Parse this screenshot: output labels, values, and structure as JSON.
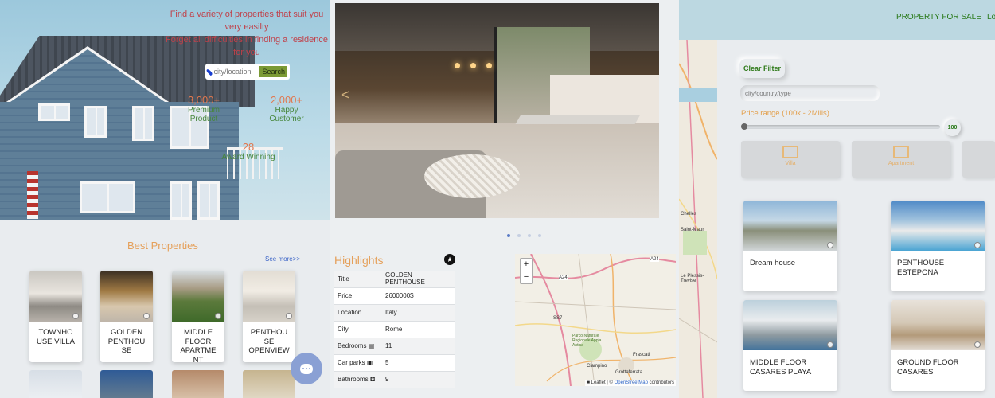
{
  "panel1": {
    "hero": {
      "line1": "Find a variety of properties that suit you very easilty",
      "line2": "Forget all difficulties in finding a residence for you"
    },
    "search": {
      "placeholder": "city/location",
      "button": "Search"
    },
    "stats": [
      {
        "num": "3,000+",
        "label": "Premium Product"
      },
      {
        "num": "2,000+",
        "label": "Happy Customer"
      },
      {
        "num": "28",
        "label": "Award Winning"
      }
    ],
    "section_title": "Best Properties",
    "see_more": "See more>>",
    "cards": [
      {
        "title": "TOWNHO USE VILLA"
      },
      {
        "title": "GOLDEN PENTHOU SE"
      },
      {
        "title": "MIDDLE FLOOR APARTME NT"
      },
      {
        "title": "PENTHOU SE OPENVIEW"
      }
    ],
    "chat_icon": "chat-icon"
  },
  "panel2": {
    "prev_arrow": "<",
    "highlights_title": "Highlights",
    "rows": [
      {
        "key": "Title",
        "value": "GOLDEN PENTHOUSE"
      },
      {
        "key": "Price",
        "value": "2600000$"
      },
      {
        "key": "Location",
        "value": "Italy"
      },
      {
        "key": "City",
        "value": "Rome"
      },
      {
        "key": "Bedrooms ▤",
        "value": "11"
      },
      {
        "key": "Car parks ▣",
        "value": "5"
      },
      {
        "key": "Bathrooms ⛾",
        "value": "9"
      }
    ],
    "map": {
      "zoom_in": "+",
      "zoom_out": "−",
      "attribution_prefix": "■ Leaflet | © ",
      "attribution_link": "OpenStreetMap",
      "attribution_suffix": " contributors",
      "labels": [
        "A24",
        "A24",
        "SS7",
        "Frascati",
        "Ciampino",
        "Grottaferrata",
        "Parco Naturale Regionale Appia Antica"
      ]
    }
  },
  "panel3": {
    "nav": [
      "PROPERTY FOR SALE",
      "Lo"
    ],
    "clear_filter": "Clear Filter",
    "city_placeholder": "city/country/type",
    "price_label": "Price range (100k - 2Mills)",
    "price_value": "100",
    "type_tiles": [
      {
        "label": "Villa"
      },
      {
        "label": "Apartment"
      },
      {
        "label": ""
      }
    ],
    "cards": [
      {
        "title": "Dream house"
      },
      {
        "title": "PENTHOUSE ESTEPONA"
      },
      {
        "title": "MIDDLE FLOOR CASARES PLAYA"
      },
      {
        "title": "GROUND FLOOR CASARES"
      }
    ],
    "map_labels": [
      "Chelles",
      "Saint-Maur",
      "Le Plessis-Trevise"
    ]
  },
  "colors": {
    "accent_orange": "#e5a05a",
    "nav_green": "#2a7a1a",
    "hero_red": "#c0414a"
  }
}
